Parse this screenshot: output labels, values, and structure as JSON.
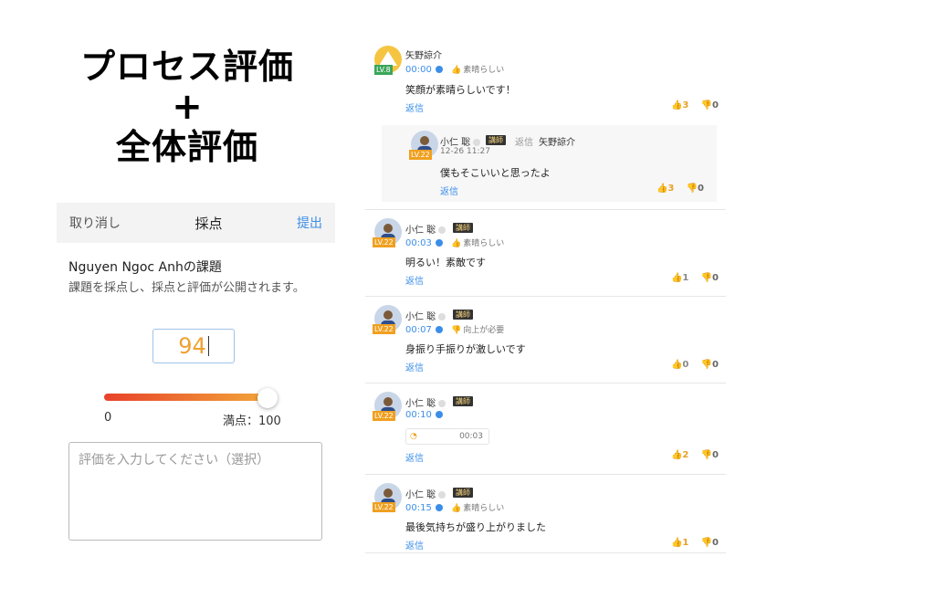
{
  "headline": {
    "line1": "プロセス評価",
    "plus": "+",
    "line2": "全体評価"
  },
  "grading": {
    "cancel_label": "取り消し",
    "title": "採点",
    "submit_label": "提出",
    "task_title": "Nguyen Ngoc Anhの課題",
    "task_description": "課題を採点し、採点と評価が公開されます。",
    "score": "94",
    "score_fraction": 0.94,
    "range_min": "0",
    "range_max": "満点：100",
    "comment_placeholder": "評価を入力してください（選択）"
  },
  "thread": {
    "comments": [
      {
        "level": "LV.8",
        "user": "矢野諒介",
        "time": "00:00",
        "tag": "素晴らしい",
        "text": "笑顔が素晴らしいです！",
        "reply_label": "返信",
        "likes": "3",
        "dislikes": "0",
        "reply": {
          "level": "LV.22",
          "user": "小仁 聡",
          "badge": "講師",
          "reply_word": "返信",
          "reply_to": "矢野諒介",
          "date": "12-26 11:27",
          "text": "僕もそこいいと思ったよ",
          "reply_label": "返信",
          "likes": "3",
          "dislikes": "0"
        }
      },
      {
        "level": "LV.22",
        "user": "小仁 聡",
        "badge": "講師",
        "time": "00:03",
        "tag": "素晴らしい",
        "text": "明るい！素敵です",
        "reply_label": "返信",
        "likes": "1",
        "dislikes": "0"
      },
      {
        "level": "LV.22",
        "user": "小仁 聡",
        "badge": "講師",
        "time": "00:07",
        "tag": "向上が必要",
        "text": "身振り手振りが激しいです",
        "reply_label": "返信",
        "likes": "0",
        "dislikes": "0"
      },
      {
        "level": "LV.22",
        "user": "小仁 聡",
        "badge": "講師",
        "time": "00:10",
        "audio_duration": "00:03",
        "reply_label": "返信",
        "likes": "2",
        "dislikes": "0"
      },
      {
        "level": "LV.22",
        "user": "小仁 聡",
        "badge": "講師",
        "time": "00:15",
        "tag": "素晴らしい",
        "text": "最後気持ちが盛り上がりました",
        "reply_label": "返信",
        "likes": "1",
        "dislikes": "0"
      }
    ]
  },
  "icons": {
    "like": "thumbs-up-icon",
    "dislike": "thumbs-down-icon",
    "play": "play-dot-icon",
    "status": "status-dot-icon",
    "audio_wave": "audio-wave-icon"
  },
  "colors": {
    "accent": "#3b8ee8",
    "score": "#f0a030",
    "slider_start": "#e8422a",
    "slider_end": "#f2a63a",
    "level_green": "#3aa65a",
    "level_orange": "#f0a020"
  }
}
